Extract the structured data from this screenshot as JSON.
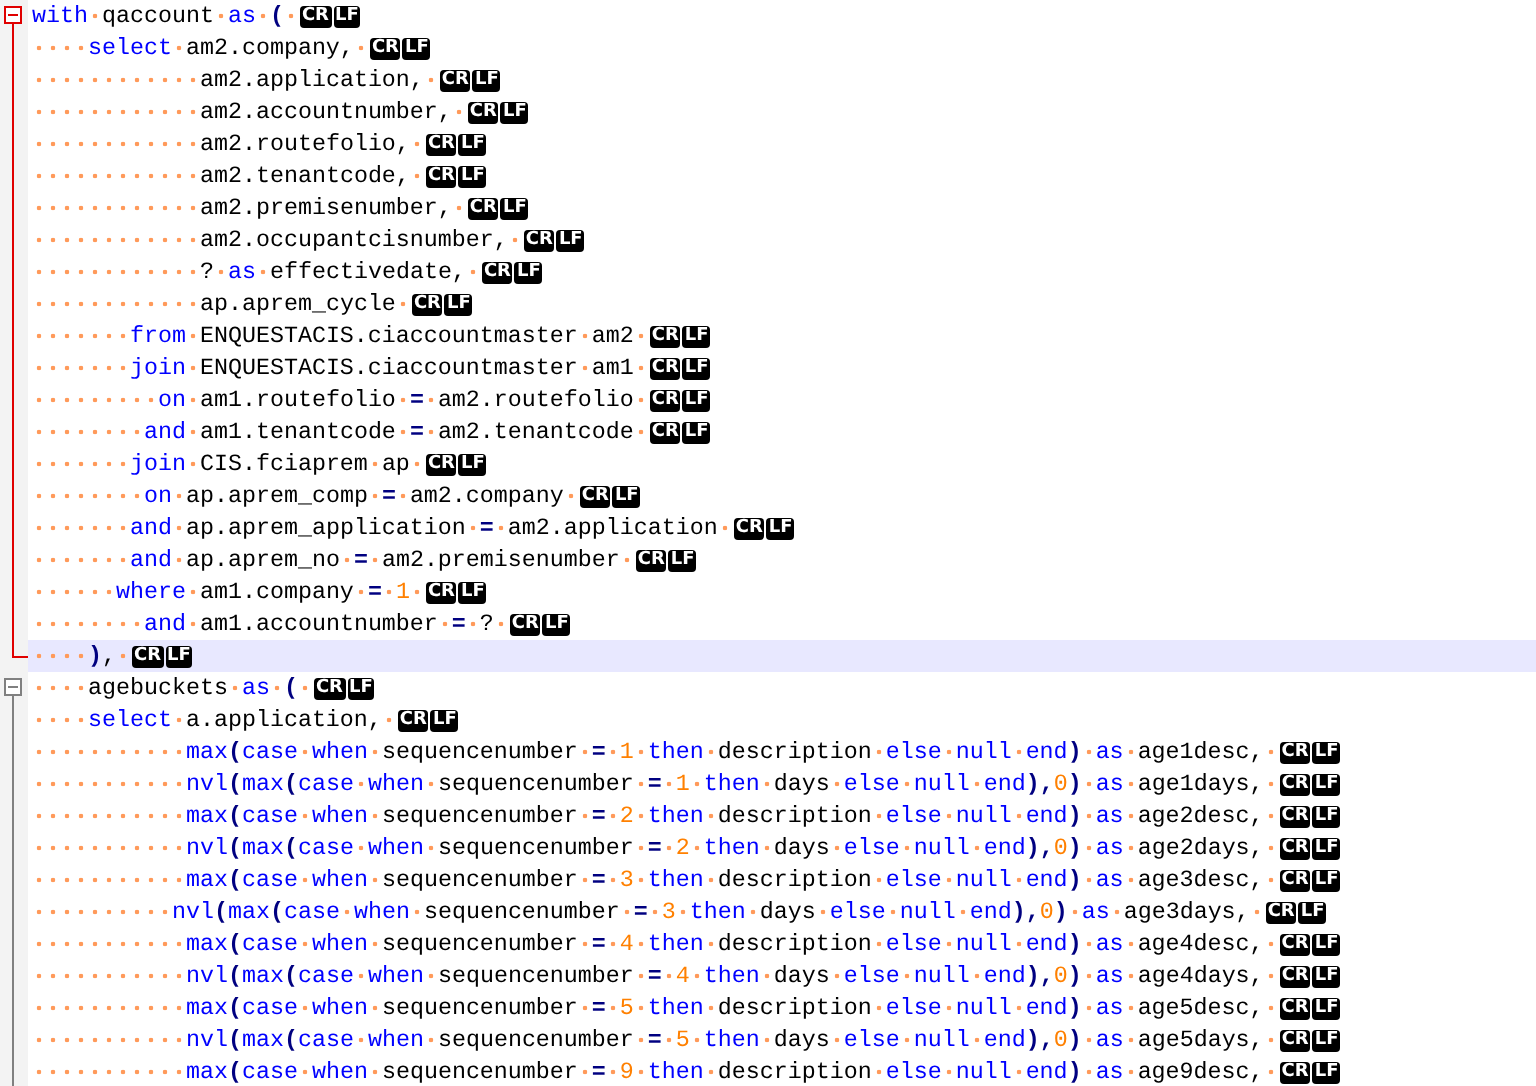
{
  "editor": {
    "lines": [
      {
        "fold_start": true,
        "fold_end": false,
        "fold_active": true,
        "current": false,
        "eol": [
          "CR",
          "LF"
        ],
        "tokens": [
          {
            "kind": "kw",
            "text": "with "
          },
          {
            "kind": "id",
            "text": "qaccount "
          },
          {
            "kind": "kw",
            "text": "as "
          },
          {
            "kind": "op",
            "text": "( "
          }
        ]
      },
      {
        "fold_start": false,
        "fold_end": false,
        "fold_active": true,
        "current": false,
        "eol": [
          "CR",
          "LF"
        ],
        "tokens": [
          {
            "kind": "kw",
            "text": "    select "
          },
          {
            "kind": "id",
            "text": "am2.company, "
          }
        ]
      },
      {
        "fold_start": false,
        "fold_end": false,
        "fold_active": true,
        "current": false,
        "eol": [
          "CR",
          "LF"
        ],
        "tokens": [
          {
            "kind": "id",
            "text": "            am2.application, "
          }
        ]
      },
      {
        "fold_start": false,
        "fold_end": false,
        "fold_active": true,
        "current": false,
        "eol": [
          "CR",
          "LF"
        ],
        "tokens": [
          {
            "kind": "id",
            "text": "            am2.accountnumber, "
          }
        ]
      },
      {
        "fold_start": false,
        "fold_end": false,
        "fold_active": true,
        "current": false,
        "eol": [
          "CR",
          "LF"
        ],
        "tokens": [
          {
            "kind": "id",
            "text": "            am2.routefolio, "
          }
        ]
      },
      {
        "fold_start": false,
        "fold_end": false,
        "fold_active": true,
        "current": false,
        "eol": [
          "CR",
          "LF"
        ],
        "tokens": [
          {
            "kind": "id",
            "text": "            am2.tenantcode, "
          }
        ]
      },
      {
        "fold_start": false,
        "fold_end": false,
        "fold_active": true,
        "current": false,
        "eol": [
          "CR",
          "LF"
        ],
        "tokens": [
          {
            "kind": "id",
            "text": "            am2.premisenumber, "
          }
        ]
      },
      {
        "fold_start": false,
        "fold_end": false,
        "fold_active": true,
        "current": false,
        "eol": [
          "CR",
          "LF"
        ],
        "tokens": [
          {
            "kind": "id",
            "text": "            am2.occupantcisnumber, "
          }
        ]
      },
      {
        "fold_start": false,
        "fold_end": false,
        "fold_active": true,
        "current": false,
        "eol": [
          "CR",
          "LF"
        ],
        "tokens": [
          {
            "kind": "id",
            "text": "            ? "
          },
          {
            "kind": "kw",
            "text": "as "
          },
          {
            "kind": "id",
            "text": "effectivedate, "
          }
        ]
      },
      {
        "fold_start": false,
        "fold_end": false,
        "fold_active": true,
        "current": false,
        "eol": [
          "CR",
          "LF"
        ],
        "tokens": [
          {
            "kind": "id",
            "text": "            ap.aprem_cycle "
          }
        ]
      },
      {
        "fold_start": false,
        "fold_end": false,
        "fold_active": true,
        "current": false,
        "eol": [
          "CR",
          "LF"
        ],
        "tokens": [
          {
            "kind": "kw",
            "text": "       from "
          },
          {
            "kind": "id",
            "text": "ENQUESTACIS.ciaccountmaster am2 "
          }
        ]
      },
      {
        "fold_start": false,
        "fold_end": false,
        "fold_active": true,
        "current": false,
        "eol": [
          "CR",
          "LF"
        ],
        "tokens": [
          {
            "kind": "kw",
            "text": "       join "
          },
          {
            "kind": "id",
            "text": "ENQUESTACIS.ciaccountmaster am1 "
          }
        ]
      },
      {
        "fold_start": false,
        "fold_end": false,
        "fold_active": true,
        "current": false,
        "eol": [
          "CR",
          "LF"
        ],
        "tokens": [
          {
            "kind": "kw",
            "text": "         on "
          },
          {
            "kind": "id",
            "text": "am1.routefolio "
          },
          {
            "kind": "op",
            "text": "= "
          },
          {
            "kind": "id",
            "text": "am2.routefolio "
          }
        ]
      },
      {
        "fold_start": false,
        "fold_end": false,
        "fold_active": true,
        "current": false,
        "eol": [
          "CR",
          "LF"
        ],
        "tokens": [
          {
            "kind": "kw",
            "text": "        and "
          },
          {
            "kind": "id",
            "text": "am1.tenantcode "
          },
          {
            "kind": "op",
            "text": "= "
          },
          {
            "kind": "id",
            "text": "am2.tenantcode "
          }
        ]
      },
      {
        "fold_start": false,
        "fold_end": false,
        "fold_active": true,
        "current": false,
        "eol": [
          "CR",
          "LF"
        ],
        "tokens": [
          {
            "kind": "kw",
            "text": "       join "
          },
          {
            "kind": "id",
            "text": "CIS.fciaprem ap "
          }
        ]
      },
      {
        "fold_start": false,
        "fold_end": false,
        "fold_active": true,
        "current": false,
        "eol": [
          "CR",
          "LF"
        ],
        "tokens": [
          {
            "kind": "kw",
            "text": "        on "
          },
          {
            "kind": "id",
            "text": "ap.aprem_comp "
          },
          {
            "kind": "op",
            "text": "= "
          },
          {
            "kind": "id",
            "text": "am2.company "
          }
        ]
      },
      {
        "fold_start": false,
        "fold_end": false,
        "fold_active": true,
        "current": false,
        "eol": [
          "CR",
          "LF"
        ],
        "tokens": [
          {
            "kind": "kw",
            "text": "       and "
          },
          {
            "kind": "id",
            "text": "ap.aprem_application "
          },
          {
            "kind": "op",
            "text": "= "
          },
          {
            "kind": "id",
            "text": "am2.application "
          }
        ]
      },
      {
        "fold_start": false,
        "fold_end": false,
        "fold_active": true,
        "current": false,
        "eol": [
          "CR",
          "LF"
        ],
        "tokens": [
          {
            "kind": "kw",
            "text": "       and "
          },
          {
            "kind": "id",
            "text": "ap.aprem_no "
          },
          {
            "kind": "op",
            "text": "= "
          },
          {
            "kind": "id",
            "text": "am2.premisenumber "
          }
        ]
      },
      {
        "fold_start": false,
        "fold_end": false,
        "fold_active": true,
        "current": false,
        "eol": [
          "CR",
          "LF"
        ],
        "tokens": [
          {
            "kind": "kw",
            "text": "      where "
          },
          {
            "kind": "id",
            "text": "am1.company "
          },
          {
            "kind": "op",
            "text": "= "
          },
          {
            "kind": "num",
            "text": "1 "
          }
        ]
      },
      {
        "fold_start": false,
        "fold_end": false,
        "fold_active": true,
        "current": false,
        "eol": [
          "CR",
          "LF"
        ],
        "tokens": [
          {
            "kind": "kw",
            "text": "        and "
          },
          {
            "kind": "id",
            "text": "am1.accountnumber "
          },
          {
            "kind": "op",
            "text": "= "
          },
          {
            "kind": "id",
            "text": "? "
          }
        ]
      },
      {
        "fold_start": false,
        "fold_end": true,
        "fold_active": true,
        "current": true,
        "eol": [
          "CR",
          "LF"
        ],
        "tokens": [
          {
            "kind": "op",
            "text": "    )"
          },
          {
            "kind": "id",
            "text": ", "
          }
        ]
      },
      {
        "fold_start": true,
        "fold_end": false,
        "fold_active": false,
        "current": false,
        "eol": [
          "CR",
          "LF"
        ],
        "tokens": [
          {
            "kind": "id",
            "text": "    agebuckets "
          },
          {
            "kind": "kw",
            "text": "as "
          },
          {
            "kind": "op",
            "text": "( "
          }
        ]
      },
      {
        "fold_start": false,
        "fold_end": false,
        "fold_active": false,
        "current": false,
        "eol": [
          "CR",
          "LF"
        ],
        "tokens": [
          {
            "kind": "kw",
            "text": "    select "
          },
          {
            "kind": "id",
            "text": "a.application, "
          }
        ]
      },
      {
        "fold_start": false,
        "fold_end": false,
        "fold_active": false,
        "current": false,
        "eol": [
          "CR",
          "LF"
        ],
        "tokens": [
          {
            "kind": "kw",
            "text": "           max"
          },
          {
            "kind": "op",
            "text": "("
          },
          {
            "kind": "kw",
            "text": "case when "
          },
          {
            "kind": "id",
            "text": "sequencenumber "
          },
          {
            "kind": "op",
            "text": "= "
          },
          {
            "kind": "num",
            "text": "1 "
          },
          {
            "kind": "kw",
            "text": "then "
          },
          {
            "kind": "id",
            "text": "description "
          },
          {
            "kind": "kw",
            "text": "else null end"
          },
          {
            "kind": "op",
            "text": ") "
          },
          {
            "kind": "kw",
            "text": "as "
          },
          {
            "kind": "id",
            "text": "age1desc, "
          }
        ]
      },
      {
        "fold_start": false,
        "fold_end": false,
        "fold_active": false,
        "current": false,
        "eol": [
          "CR",
          "LF"
        ],
        "tokens": [
          {
            "kind": "kw",
            "text": "           nvl"
          },
          {
            "kind": "op",
            "text": "("
          },
          {
            "kind": "kw",
            "text": "max"
          },
          {
            "kind": "op",
            "text": "("
          },
          {
            "kind": "kw",
            "text": "case when "
          },
          {
            "kind": "id",
            "text": "sequencenumber "
          },
          {
            "kind": "op",
            "text": "= "
          },
          {
            "kind": "num",
            "text": "1 "
          },
          {
            "kind": "kw",
            "text": "then "
          },
          {
            "kind": "id",
            "text": "days "
          },
          {
            "kind": "kw",
            "text": "else null end"
          },
          {
            "kind": "op",
            "text": "),"
          },
          {
            "kind": "num",
            "text": "0"
          },
          {
            "kind": "op",
            "text": ") "
          },
          {
            "kind": "kw",
            "text": "as "
          },
          {
            "kind": "id",
            "text": "age1days, "
          }
        ]
      },
      {
        "fold_start": false,
        "fold_end": false,
        "fold_active": false,
        "current": false,
        "eol": [
          "CR",
          "LF"
        ],
        "tokens": [
          {
            "kind": "kw",
            "text": "           max"
          },
          {
            "kind": "op",
            "text": "("
          },
          {
            "kind": "kw",
            "text": "case when "
          },
          {
            "kind": "id",
            "text": "sequencenumber "
          },
          {
            "kind": "op",
            "text": "= "
          },
          {
            "kind": "num",
            "text": "2 "
          },
          {
            "kind": "kw",
            "text": "then "
          },
          {
            "kind": "id",
            "text": "description "
          },
          {
            "kind": "kw",
            "text": "else null end"
          },
          {
            "kind": "op",
            "text": ") "
          },
          {
            "kind": "kw",
            "text": "as "
          },
          {
            "kind": "id",
            "text": "age2desc, "
          }
        ]
      },
      {
        "fold_start": false,
        "fold_end": false,
        "fold_active": false,
        "current": false,
        "eol": [
          "CR",
          "LF"
        ],
        "tokens": [
          {
            "kind": "kw",
            "text": "           nvl"
          },
          {
            "kind": "op",
            "text": "("
          },
          {
            "kind": "kw",
            "text": "max"
          },
          {
            "kind": "op",
            "text": "("
          },
          {
            "kind": "kw",
            "text": "case when "
          },
          {
            "kind": "id",
            "text": "sequencenumber "
          },
          {
            "kind": "op",
            "text": "= "
          },
          {
            "kind": "num",
            "text": "2 "
          },
          {
            "kind": "kw",
            "text": "then "
          },
          {
            "kind": "id",
            "text": "days "
          },
          {
            "kind": "kw",
            "text": "else null end"
          },
          {
            "kind": "op",
            "text": "),"
          },
          {
            "kind": "num",
            "text": "0"
          },
          {
            "kind": "op",
            "text": ") "
          },
          {
            "kind": "kw",
            "text": "as "
          },
          {
            "kind": "id",
            "text": "age2days, "
          }
        ]
      },
      {
        "fold_start": false,
        "fold_end": false,
        "fold_active": false,
        "current": false,
        "eol": [
          "CR",
          "LF"
        ],
        "tokens": [
          {
            "kind": "kw",
            "text": "           max"
          },
          {
            "kind": "op",
            "text": "("
          },
          {
            "kind": "kw",
            "text": "case when "
          },
          {
            "kind": "id",
            "text": "sequencenumber "
          },
          {
            "kind": "op",
            "text": "= "
          },
          {
            "kind": "num",
            "text": "3 "
          },
          {
            "kind": "kw",
            "text": "then "
          },
          {
            "kind": "id",
            "text": "description "
          },
          {
            "kind": "kw",
            "text": "else null end"
          },
          {
            "kind": "op",
            "text": ") "
          },
          {
            "kind": "kw",
            "text": "as "
          },
          {
            "kind": "id",
            "text": "age3desc, "
          }
        ]
      },
      {
        "fold_start": false,
        "fold_end": false,
        "fold_active": false,
        "current": false,
        "eol": [
          "CR",
          "LF"
        ],
        "tokens": [
          {
            "kind": "kw",
            "text": "          nvl"
          },
          {
            "kind": "op",
            "text": "("
          },
          {
            "kind": "kw",
            "text": "max"
          },
          {
            "kind": "op",
            "text": "("
          },
          {
            "kind": "kw",
            "text": "case when "
          },
          {
            "kind": "id",
            "text": "sequencenumber "
          },
          {
            "kind": "op",
            "text": "= "
          },
          {
            "kind": "num",
            "text": "3 "
          },
          {
            "kind": "kw",
            "text": "then "
          },
          {
            "kind": "id",
            "text": "days "
          },
          {
            "kind": "kw",
            "text": "else null end"
          },
          {
            "kind": "op",
            "text": "),"
          },
          {
            "kind": "num",
            "text": "0"
          },
          {
            "kind": "op",
            "text": ") "
          },
          {
            "kind": "kw",
            "text": "as "
          },
          {
            "kind": "id",
            "text": "age3days, "
          }
        ]
      },
      {
        "fold_start": false,
        "fold_end": false,
        "fold_active": false,
        "current": false,
        "eol": [
          "CR",
          "LF"
        ],
        "tokens": [
          {
            "kind": "kw",
            "text": "           max"
          },
          {
            "kind": "op",
            "text": "("
          },
          {
            "kind": "kw",
            "text": "case when "
          },
          {
            "kind": "id",
            "text": "sequencenumber "
          },
          {
            "kind": "op",
            "text": "= "
          },
          {
            "kind": "num",
            "text": "4 "
          },
          {
            "kind": "kw",
            "text": "then "
          },
          {
            "kind": "id",
            "text": "description "
          },
          {
            "kind": "kw",
            "text": "else null end"
          },
          {
            "kind": "op",
            "text": ") "
          },
          {
            "kind": "kw",
            "text": "as "
          },
          {
            "kind": "id",
            "text": "age4desc, "
          }
        ]
      },
      {
        "fold_start": false,
        "fold_end": false,
        "fold_active": false,
        "current": false,
        "eol": [
          "CR",
          "LF"
        ],
        "tokens": [
          {
            "kind": "kw",
            "text": "           nvl"
          },
          {
            "kind": "op",
            "text": "("
          },
          {
            "kind": "kw",
            "text": "max"
          },
          {
            "kind": "op",
            "text": "("
          },
          {
            "kind": "kw",
            "text": "case when "
          },
          {
            "kind": "id",
            "text": "sequencenumber "
          },
          {
            "kind": "op",
            "text": "= "
          },
          {
            "kind": "num",
            "text": "4 "
          },
          {
            "kind": "kw",
            "text": "then "
          },
          {
            "kind": "id",
            "text": "days "
          },
          {
            "kind": "kw",
            "text": "else null end"
          },
          {
            "kind": "op",
            "text": "),"
          },
          {
            "kind": "num",
            "text": "0"
          },
          {
            "kind": "op",
            "text": ") "
          },
          {
            "kind": "kw",
            "text": "as "
          },
          {
            "kind": "id",
            "text": "age4days, "
          }
        ]
      },
      {
        "fold_start": false,
        "fold_end": false,
        "fold_active": false,
        "current": false,
        "eol": [
          "CR",
          "LF"
        ],
        "tokens": [
          {
            "kind": "kw",
            "text": "           max"
          },
          {
            "kind": "op",
            "text": "("
          },
          {
            "kind": "kw",
            "text": "case when "
          },
          {
            "kind": "id",
            "text": "sequencenumber "
          },
          {
            "kind": "op",
            "text": "= "
          },
          {
            "kind": "num",
            "text": "5 "
          },
          {
            "kind": "kw",
            "text": "then "
          },
          {
            "kind": "id",
            "text": "description "
          },
          {
            "kind": "kw",
            "text": "else null end"
          },
          {
            "kind": "op",
            "text": ") "
          },
          {
            "kind": "kw",
            "text": "as "
          },
          {
            "kind": "id",
            "text": "age5desc, "
          }
        ]
      },
      {
        "fold_start": false,
        "fold_end": false,
        "fold_active": false,
        "current": false,
        "eol": [
          "CR",
          "LF"
        ],
        "tokens": [
          {
            "kind": "kw",
            "text": "           nvl"
          },
          {
            "kind": "op",
            "text": "("
          },
          {
            "kind": "kw",
            "text": "max"
          },
          {
            "kind": "op",
            "text": "("
          },
          {
            "kind": "kw",
            "text": "case when "
          },
          {
            "kind": "id",
            "text": "sequencenumber "
          },
          {
            "kind": "op",
            "text": "= "
          },
          {
            "kind": "num",
            "text": "5 "
          },
          {
            "kind": "kw",
            "text": "then "
          },
          {
            "kind": "id",
            "text": "days "
          },
          {
            "kind": "kw",
            "text": "else null end"
          },
          {
            "kind": "op",
            "text": "),"
          },
          {
            "kind": "num",
            "text": "0"
          },
          {
            "kind": "op",
            "text": ") "
          },
          {
            "kind": "kw",
            "text": "as "
          },
          {
            "kind": "id",
            "text": "age5days, "
          }
        ]
      },
      {
        "fold_start": false,
        "fold_end": false,
        "fold_active": false,
        "current": false,
        "eol": [
          "CR",
          "LF"
        ],
        "tokens": [
          {
            "kind": "kw",
            "text": "           max"
          },
          {
            "kind": "op",
            "text": "("
          },
          {
            "kind": "kw",
            "text": "case when "
          },
          {
            "kind": "id",
            "text": "sequencenumber "
          },
          {
            "kind": "op",
            "text": "= "
          },
          {
            "kind": "num",
            "text": "9 "
          },
          {
            "kind": "kw",
            "text": "then "
          },
          {
            "kind": "id",
            "text": "description "
          },
          {
            "kind": "kw",
            "text": "else null end"
          },
          {
            "kind": "op",
            "text": ") "
          },
          {
            "kind": "kw",
            "text": "as "
          },
          {
            "kind": "id",
            "text": "age9desc, "
          }
        ]
      }
    ]
  }
}
